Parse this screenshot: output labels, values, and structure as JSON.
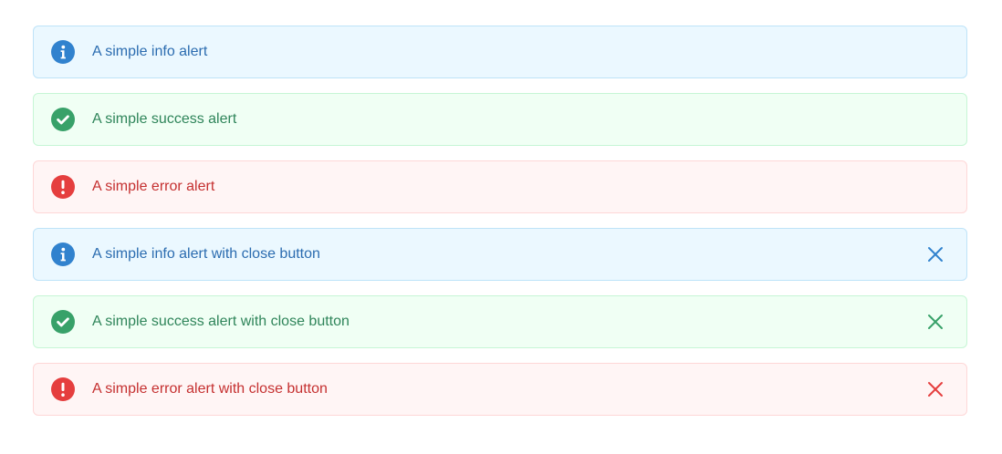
{
  "colors": {
    "info_icon": "#3182ce",
    "success_icon": "#38a169",
    "error_icon": "#e53e3e",
    "info_bg": "#ebf8ff",
    "success_bg": "#f0fff4",
    "error_bg": "#fff5f5"
  },
  "alerts": [
    {
      "type": "info",
      "icon": "info-icon",
      "message": "A simple info alert"
    },
    {
      "type": "success",
      "icon": "check-circle-icon",
      "message": "A simple success alert"
    },
    {
      "type": "error",
      "icon": "exclamation-circle-icon",
      "message": "A simple error alert"
    },
    {
      "type": "info",
      "icon": "info-icon",
      "message": "A simple info alert with close button",
      "close_icon": "close-icon"
    },
    {
      "type": "success",
      "icon": "check-circle-icon",
      "message": "A simple success alert with close button",
      "close_icon": "close-icon"
    },
    {
      "type": "error",
      "icon": "exclamation-circle-icon",
      "message": "A simple error alert with close button",
      "close_icon": "close-icon"
    }
  ]
}
